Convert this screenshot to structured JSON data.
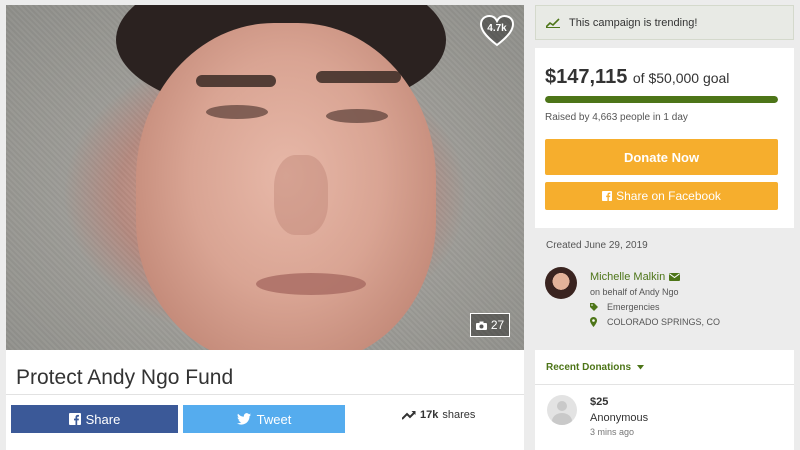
{
  "campaign": {
    "title": "Protect Andy Ngo Fund",
    "likes": "4.7k",
    "photo_count": "27"
  },
  "social": {
    "facebook_label": "Share",
    "twitter_label": "Tweet",
    "shares_count": "17k",
    "shares_label": "shares"
  },
  "sidebar": {
    "trending_text": "This campaign is trending!",
    "raised_amount": "$147,115",
    "goal_text": "of $50,000 goal",
    "progress_fraction": 1.0,
    "raised_by": "Raised by 4,663 people in 1 day",
    "donate_label": "Donate Now",
    "share_fb_label": "Share on Facebook"
  },
  "organizer": {
    "created": "Created June 29, 2019",
    "name": "Michelle Malkin",
    "on_behalf": "on behalf of Andy Ngo",
    "category": "Emergencies",
    "location": "COLORADO SPRINGS, CO"
  },
  "donations": {
    "header": "Recent Donations",
    "items": [
      {
        "amount": "$25",
        "name": "Anonymous",
        "time": "3 mins ago"
      }
    ]
  },
  "colors": {
    "brand_green": "#4d7518",
    "donate_orange": "#f6ae2d",
    "facebook_blue": "#3b5998",
    "twitter_blue": "#55acee"
  }
}
